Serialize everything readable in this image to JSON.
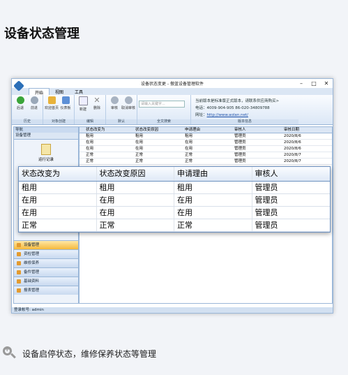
{
  "heading": "设备状态管理",
  "window": {
    "title": "设备状态变更 - 傲蓝设备管理软件",
    "controls": [
      "–",
      "□",
      "✕"
    ]
  },
  "ribbon_tabs": [
    "开始",
    "视图",
    "工具"
  ],
  "ribbon": {
    "history": {
      "label": "历史",
      "back": "后退",
      "forward": "前进"
    },
    "object_group": {
      "label": "对象创建",
      "welcome": "欢迎首页",
      "dashboard": "仪表板"
    },
    "edit_group": {
      "label": "编辑",
      "new": "新建",
      "delete": "删除"
    },
    "approve_group": {
      "label": "默认",
      "approve": "审核",
      "unapprove": "取消审核"
    },
    "search_group": {
      "label": "全文搜索",
      "placeholder": "请输入关键字..."
    },
    "info_group": {
      "label": "版本信息",
      "line1": "当前版本是标准版正式版本，请联系供应商购买>",
      "phone_label": "电话：",
      "phone": "4009-904-905  86-020-34809788",
      "web_label": "网址：",
      "web": "http://www.aolan.net/"
    }
  },
  "sidebar": {
    "header": "导航",
    "section": "设备管理",
    "record_label": "运行记录",
    "items": [
      "设备管理",
      "资检管理",
      "维修保养",
      "备件管理",
      "基础资料",
      "报表管理"
    ]
  },
  "grid": {
    "columns": [
      "状态改变为",
      "状态改变原因",
      "申请理由",
      "审核人",
      "审核日期"
    ],
    "rows": [
      [
        "租用",
        "租用",
        "租用",
        "管理员",
        "2020/8/6"
      ],
      [
        "在用",
        "在用",
        "在用",
        "管理员",
        "2020/8/6"
      ],
      [
        "在用",
        "在用",
        "在用",
        "管理员",
        "2020/8/6"
      ],
      [
        "正常",
        "正常",
        "正常",
        "管理员",
        "2020/8/7"
      ],
      [
        "正常",
        "正常",
        "正常",
        "管理员",
        "2020/8/7"
      ]
    ]
  },
  "status_bar": "登录帐号: admin",
  "zoom": {
    "columns": [
      "状态改变为",
      "状态改变原因",
      "申请理由",
      "审核人"
    ],
    "rows": [
      [
        "租用",
        "租用",
        "租用",
        "管理员"
      ],
      [
        "在用",
        "在用",
        "在用",
        "管理员"
      ],
      [
        "在用",
        "在用",
        "在用",
        "管理员"
      ],
      [
        "正常",
        "正常",
        "正常",
        "管理员"
      ]
    ]
  },
  "caption": "设备启停状态，维修保养状态等管理"
}
